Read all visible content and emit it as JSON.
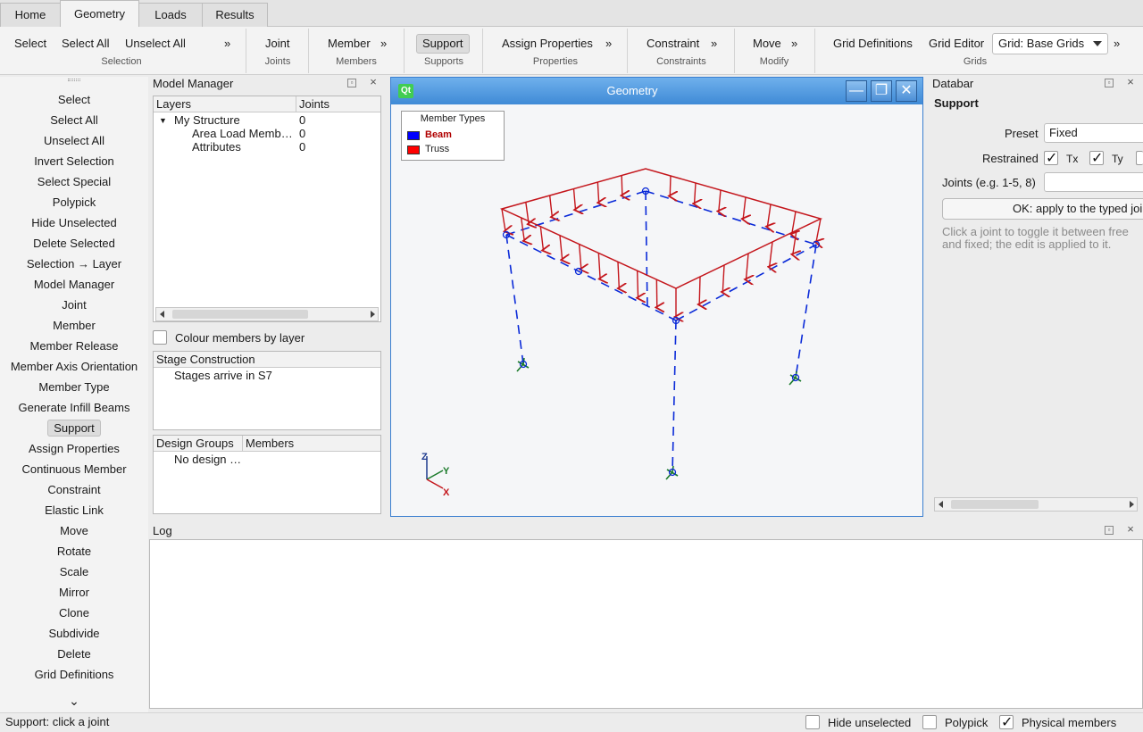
{
  "tabs": [
    "Home",
    "Geometry",
    "Loads",
    "Results"
  ],
  "active_tab": "Geometry",
  "ribbon": {
    "groups": [
      {
        "label": "Selection",
        "items": [
          "Select",
          "Select All",
          "Unselect All"
        ]
      },
      {
        "label": "Joints",
        "items": [
          "Joint"
        ]
      },
      {
        "label": "Members",
        "items": [
          "Member"
        ]
      },
      {
        "label": "Supports",
        "items": [
          "Support"
        ]
      },
      {
        "label": "Properties",
        "items": [
          "Assign Properties"
        ]
      },
      {
        "label": "Constraints",
        "items": [
          "Constraint"
        ]
      },
      {
        "label": "Modify",
        "items": [
          "Move"
        ]
      },
      {
        "label": "Grids",
        "items": [
          "Grid Definitions",
          "Grid Editor"
        ]
      }
    ],
    "more_glyph": "»",
    "grid_combo_value": "Grid: Base Grids"
  },
  "left_tools": {
    "items": [
      "Select",
      "Select All",
      "Unselect All",
      "Invert Selection",
      "Select Special",
      "Polypick",
      "Hide Unselected",
      "Delete Selected",
      "Selection → Layer",
      "Model Manager",
      "Joint",
      "Member",
      "Member Release",
      "Member Axis Orientation",
      "Member Type",
      "Generate Infill Beams",
      "Support",
      "Assign Properties",
      "Continuous Member",
      "Constraint",
      "Elastic Link",
      "Move",
      "Rotate",
      "Scale",
      "Mirror",
      "Clone",
      "Subdivide",
      "Delete",
      "Grid Definitions"
    ],
    "active": "Support",
    "expand_glyph": "⌄"
  },
  "model_manager": {
    "title": "Model Manager",
    "columns": [
      "Layers",
      "Joints"
    ],
    "rows": [
      {
        "name": "My Structure",
        "joints": "0"
      },
      {
        "name": "Area Load Memb…",
        "joints": "0"
      },
      {
        "name": "Attributes",
        "joints": "0"
      }
    ],
    "colour_by_layer_label": "Colour members by layer",
    "stage_header": "Stage Construction",
    "stage_text": "Stages arrive in S7",
    "design_columns": [
      "Design Groups",
      "Members"
    ],
    "design_text": "No design …"
  },
  "geometry_window": {
    "title": "Geometry",
    "app_logo": "Qt",
    "legend_title": "Member Types",
    "legend": [
      {
        "name": "Beam",
        "color": "#0000ff",
        "text_color": "#b00000"
      },
      {
        "name": "Truss",
        "color": "#ff0000",
        "text_color": "#1a1a1a"
      }
    ],
    "axes": {
      "x": "X",
      "y": "Y",
      "z": "Z"
    },
    "colors": {
      "member": "#0a2ad8",
      "load": "#c4161c",
      "support": "#1a7a2a"
    }
  },
  "databar": {
    "title": "Databar",
    "section": "Support",
    "preset_label": "Preset",
    "preset_value": "Fixed",
    "restrained_label": "Restrained",
    "restrained": [
      {
        "label": "Tx",
        "checked": true
      },
      {
        "label": "Ty",
        "checked": true
      }
    ],
    "joints_label": "Joints (e.g. 1-5, 8)",
    "joints_value": "",
    "apply_button": "OK: apply to the typed joints",
    "hint": "Click a joint to toggle it between free and fixed; the edit is applied to it."
  },
  "log": {
    "title": "Log"
  },
  "status": {
    "message": "Support: click a joint",
    "toggles": [
      {
        "label": "Hide unselected",
        "checked": false
      },
      {
        "label": "Polypick",
        "checked": false
      },
      {
        "label": "Physical members",
        "checked": true
      }
    ]
  },
  "dock_float_glyph": "▫",
  "dock_close_glyph": "×",
  "check_glyph": "✓",
  "win_buttons": {
    "minimize": "—",
    "maximize": "❐",
    "close": "✕"
  }
}
